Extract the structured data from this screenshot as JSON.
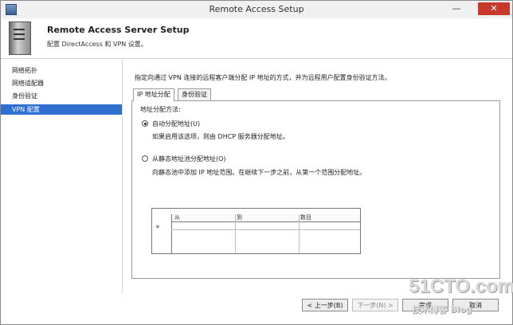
{
  "window": {
    "title": "Remote Access Setup",
    "minimize": "—",
    "close": "✕"
  },
  "header": {
    "title": "Remote Access Server Setup",
    "subtitle": "配置 DirectAccess 和 VPN 设置。"
  },
  "sidebar": {
    "items": [
      {
        "label": "网络拓扑"
      },
      {
        "label": "网络适配器"
      },
      {
        "label": "身份验证"
      },
      {
        "label": "VPN 配置"
      }
    ],
    "active_index": 3
  },
  "content": {
    "description": "指定向通过 VPN 连接的远程客户端分配 IP 地址的方式，并为远程用户配置身份验证方法。",
    "tabs": [
      {
        "label": "IP 地址分配"
      },
      {
        "label": "身份验证"
      }
    ],
    "section_label": "地址分配方法:",
    "option_auto": {
      "label": "自动分配地址(U)",
      "hint": "如果启用该选项，则由 DHCP 服务器分配地址。",
      "checked": true
    },
    "option_static": {
      "label": "从静态地址池分配地址(O)",
      "hint": "向静态池中添加 IP 地址范围。在继续下一步之前，从第一个范围分配地址。",
      "checked": false
    },
    "grid": {
      "caption": "",
      "columns": [
        "从",
        "到",
        "数目"
      ],
      "row_marker": "✳"
    }
  },
  "buttons": {
    "back": "< 上一步(B)",
    "next": "下一步(N) >",
    "finish": "完成",
    "cancel": "取消"
  },
  "watermark": {
    "brand": "51CTO.com",
    "tagline": "技术博客  Blog"
  }
}
